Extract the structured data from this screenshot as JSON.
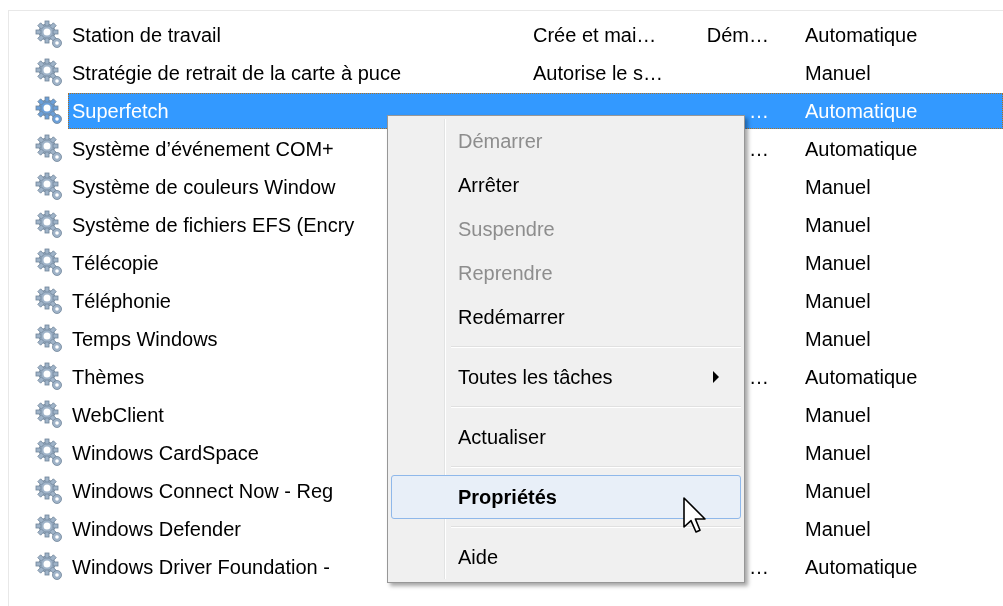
{
  "services": [
    {
      "name": "Station de travail",
      "description": "Crée et mai…",
      "status": "Dém…",
      "startup": "Automatique",
      "selected": false
    },
    {
      "name": "Stratégie de retrait de la carte à puce",
      "description": "Autorise le s…",
      "startup": "Manuel",
      "selected": false
    },
    {
      "name": "Superfetch",
      "status": "…",
      "startup": "Automatique",
      "selected": true
    },
    {
      "name": "Système d’événement COM+",
      "status": "…",
      "startup": "Automatique",
      "selected": false
    },
    {
      "name": "Système de couleurs Window",
      "startup": "Manuel",
      "selected": false
    },
    {
      "name": "Système de fichiers EFS (Encry",
      "startup": "Manuel",
      "selected": false
    },
    {
      "name": "Télécopie",
      "startup": "Manuel",
      "selected": false
    },
    {
      "name": "Téléphonie",
      "startup": "Manuel",
      "selected": false
    },
    {
      "name": "Temps Windows",
      "startup": "Manuel",
      "selected": false
    },
    {
      "name": "Thèmes",
      "status": "…",
      "startup": "Automatique",
      "selected": false
    },
    {
      "name": "WebClient",
      "startup": "Manuel",
      "selected": false
    },
    {
      "name": "Windows CardSpace",
      "startup": "Manuel",
      "selected": false
    },
    {
      "name": "Windows Connect Now - Reg",
      "startup": "Manuel",
      "selected": false
    },
    {
      "name": "Windows Defender",
      "startup": "Manuel",
      "selected": false
    },
    {
      "name": "Windows Driver Foundation -",
      "status": "…",
      "startup": "Automatique",
      "selected": false
    }
  ],
  "context_menu": [
    {
      "kind": "item",
      "label": "Démarrer",
      "disabled": true,
      "highlighted": false
    },
    {
      "kind": "item",
      "label": "Arrêter",
      "disabled": false,
      "highlighted": false
    },
    {
      "kind": "item",
      "label": "Suspendre",
      "disabled": true,
      "highlighted": false
    },
    {
      "kind": "item",
      "label": "Reprendre",
      "disabled": true,
      "highlighted": false
    },
    {
      "kind": "item",
      "label": "Redémarrer",
      "disabled": false,
      "highlighted": false
    },
    {
      "kind": "separator"
    },
    {
      "kind": "submenu",
      "label": "Toutes les tâches",
      "disabled": false,
      "highlighted": false
    },
    {
      "kind": "separator"
    },
    {
      "kind": "item",
      "label": "Actualiser",
      "disabled": false,
      "highlighted": false
    },
    {
      "kind": "separator"
    },
    {
      "kind": "default",
      "label": "Propriétés",
      "disabled": false,
      "highlighted": true
    },
    {
      "kind": "separator"
    },
    {
      "kind": "item",
      "label": "Aide",
      "disabled": false,
      "highlighted": false
    }
  ]
}
